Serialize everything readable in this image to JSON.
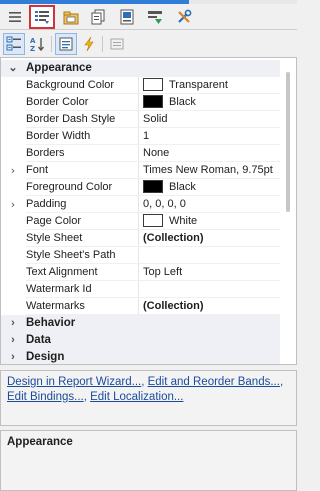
{
  "tabs": [
    {
      "icon": "hamburger-menu-icon",
      "selected": false
    },
    {
      "icon": "property-grid-icon",
      "selected": true
    },
    {
      "icon": "field-list-icon",
      "selected": false
    },
    {
      "icon": "report-explorer-icon",
      "selected": false
    },
    {
      "icon": "report-gallery-icon",
      "selected": false
    },
    {
      "icon": "group-sort-icon",
      "selected": false
    },
    {
      "icon": "tools-icon",
      "selected": false
    }
  ],
  "toolbar": [
    {
      "icon": "categorized-icon",
      "active": true
    },
    {
      "icon": "alphabetical-sort-icon",
      "active": false
    },
    {
      "icon": "properties-view-icon",
      "active": true
    },
    {
      "icon": "events-lightning-icon",
      "active": false
    },
    {
      "icon": "property-pages-icon",
      "active": false
    }
  ],
  "grid": {
    "appearance_label": "Appearance",
    "properties": [
      {
        "name": "Background Color",
        "value": "Transparent",
        "swatch": "#ffffff",
        "expand": "",
        "bold": false
      },
      {
        "name": "Border Color",
        "value": "Black",
        "swatch": "#000000",
        "expand": "",
        "bold": false
      },
      {
        "name": "Border Dash Style",
        "value": "Solid",
        "swatch": "",
        "expand": "",
        "bold": false
      },
      {
        "name": "Border Width",
        "value": "1",
        "swatch": "",
        "expand": "",
        "bold": false
      },
      {
        "name": "Borders",
        "value": "None",
        "swatch": "",
        "expand": "",
        "bold": false
      },
      {
        "name": "Font",
        "value": "Times New Roman, 9.75pt",
        "swatch": "",
        "expand": "›",
        "bold": false
      },
      {
        "name": "Foreground Color",
        "value": "Black",
        "swatch": "#000000",
        "expand": "",
        "bold": false
      },
      {
        "name": "Padding",
        "value": "0, 0, 0, 0",
        "swatch": "",
        "expand": "›",
        "bold": false
      },
      {
        "name": "Page Color",
        "value": "White",
        "swatch": "#ffffff",
        "expand": "",
        "bold": false
      },
      {
        "name": "Style Sheet",
        "value": "(Collection)",
        "swatch": "",
        "expand": "",
        "bold": true
      },
      {
        "name": "Style Sheet's Path",
        "value": "",
        "swatch": "",
        "expand": "",
        "bold": false
      },
      {
        "name": "Text Alignment",
        "value": "Top Left",
        "swatch": "",
        "expand": "",
        "bold": false
      },
      {
        "name": "Watermark Id",
        "value": "",
        "swatch": "",
        "expand": "",
        "bold": false
      },
      {
        "name": "Watermarks",
        "value": "(Collection)",
        "swatch": "",
        "expand": "",
        "bold": true
      }
    ],
    "collapsed_categories": [
      {
        "label": "Behavior"
      },
      {
        "label": "Data"
      },
      {
        "label": "Design"
      }
    ]
  },
  "verbs": {
    "design_wizard": "Design in Report Wizard...",
    "sep1": ", ",
    "edit_bands": "Edit and Reorder Bands...",
    "sep2": ", ",
    "edit_bindings": "Edit Bindings...",
    "sep3": ", ",
    "edit_localization": "Edit Localization..."
  },
  "description": {
    "title": "Appearance"
  },
  "colors": {
    "accent": "#2f7dd7",
    "selected_tab_border": "#d13438",
    "link": "#1a4b9b",
    "category_bg": "#eef0f5"
  }
}
